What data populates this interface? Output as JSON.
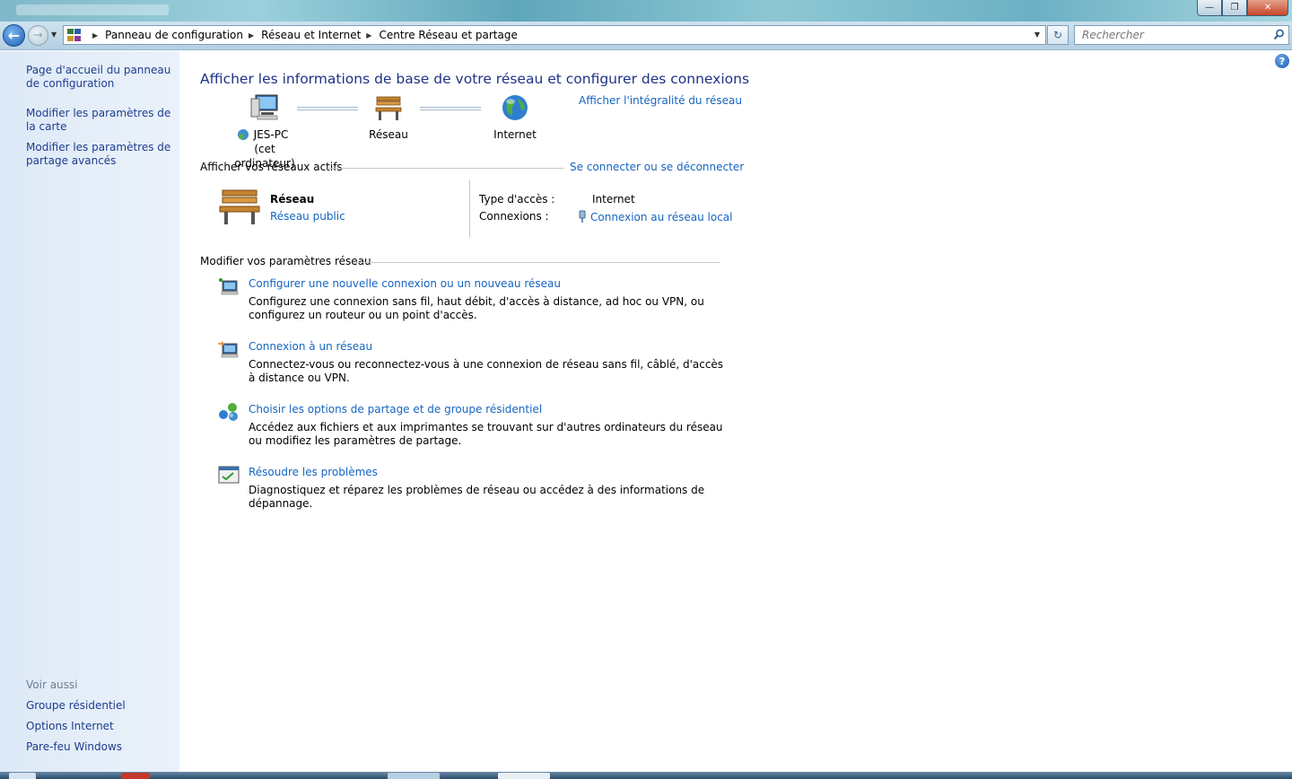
{
  "window": {
    "minimize_glyph": "—",
    "maximize_glyph": "❐",
    "close_glyph": "✕"
  },
  "address": {
    "breadcrumbs": [
      "Panneau de configuration",
      "Réseau et Internet",
      "Centre Réseau et partage"
    ],
    "search_placeholder": "Recherche​r"
  },
  "sidebar": {
    "items": [
      {
        "label": "Page d'accueil du panneau de configuration"
      },
      {
        "label": "Modifier les paramètres de la carte"
      },
      {
        "label": "Modifier les paramètres de partage avancés"
      }
    ],
    "see_also_heading": "Voir aussi",
    "see_also": [
      {
        "label": "Groupe résidentiel"
      },
      {
        "label": "Options Internet"
      },
      {
        "label": "Pare-feu Windows"
      }
    ]
  },
  "main": {
    "title": "Afficher les informations de base de votre réseau et configurer des connexions",
    "full_map_link": "Afficher l'intégralité du réseau",
    "map": {
      "computer_name": "JES-PC",
      "computer_sub": "(cet ordinateur)",
      "network_label": "Réseau",
      "internet_label": "Internet"
    },
    "active_networks": {
      "heading": "Afficher vos réseaux actifs",
      "connect_link": "Se connecter ou se déconnecter",
      "network_name": "Réseau",
      "network_category": "Réseau public",
      "access_type_label": "Type d'accès :",
      "access_type_value": "Internet",
      "connections_label": "Connexions :",
      "connections_value": "Connexion au réseau local"
    },
    "change_settings": {
      "heading": "Modifier vos paramètres réseau",
      "tasks": [
        {
          "title": "Configurer une nouvelle connexion ou un nouveau réseau",
          "desc": "Configurez une connexion sans fil, haut débit, d'accès à distance, ad hoc ou VPN, ou configurez un routeur ou un point d'accès.",
          "icon": "new-connection-icon"
        },
        {
          "title": "Connexion à un réseau",
          "desc": "Connectez-vous ou reconnectez-vous à une connexion de réseau sans fil, câblé, d'accès à distance ou VPN.",
          "icon": "connect-network-icon"
        },
        {
          "title": "Choisir les options de partage et de groupe résidentiel",
          "desc": "Accédez aux fichiers et aux imprimantes se trouvant sur d'autres ordinateurs du réseau ou modifiez les paramètres de partage.",
          "icon": "homegroup-icon"
        },
        {
          "title": "Résoudre les problèmes",
          "desc": "Diagnostiquez et réparez les problèmes de réseau ou accédez à des informations de dépannage.",
          "icon": "troubleshoot-icon"
        }
      ]
    }
  }
}
